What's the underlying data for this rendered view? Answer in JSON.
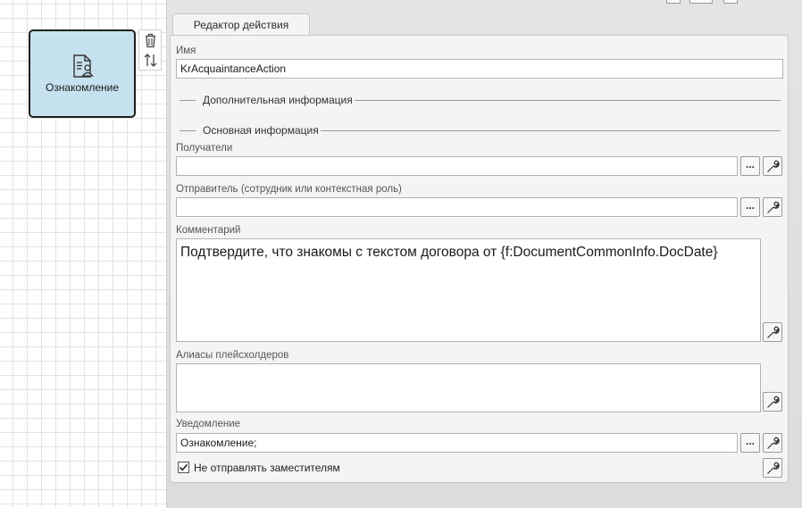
{
  "canvas": {
    "node": {
      "label": "Ознакомление",
      "icon": "document-user-icon",
      "fill": "#c6e2ee"
    },
    "tools": {
      "delete_icon": "trash-icon",
      "swap_icon": "swap-arrows-icon"
    }
  },
  "editor": {
    "tab_label": "Редактор действия",
    "name": {
      "label": "Имя",
      "value": "KrAcquaintanceAction"
    },
    "sections": {
      "additional": "Дополнительная информация",
      "main": "Основная информация"
    },
    "recipients": {
      "label": "Получатели",
      "value": ""
    },
    "sender": {
      "label": "Отправитель (сотрудник или контекстная роль)",
      "value": ""
    },
    "comment": {
      "label": "Комментарий",
      "value": "Подтвердите, что знакомы с текстом договора от {f:DocumentCommonInfo.DocDate}"
    },
    "aliases": {
      "label": "Алиасы плейсхолдеров",
      "value": ""
    },
    "notification": {
      "label": "Уведомление",
      "value": "Ознакомление;"
    },
    "no_deputies": {
      "label": "Не отправлять заместителям",
      "checked": true
    },
    "browse_label": "...",
    "wrench_icon": "wrench-icon"
  }
}
